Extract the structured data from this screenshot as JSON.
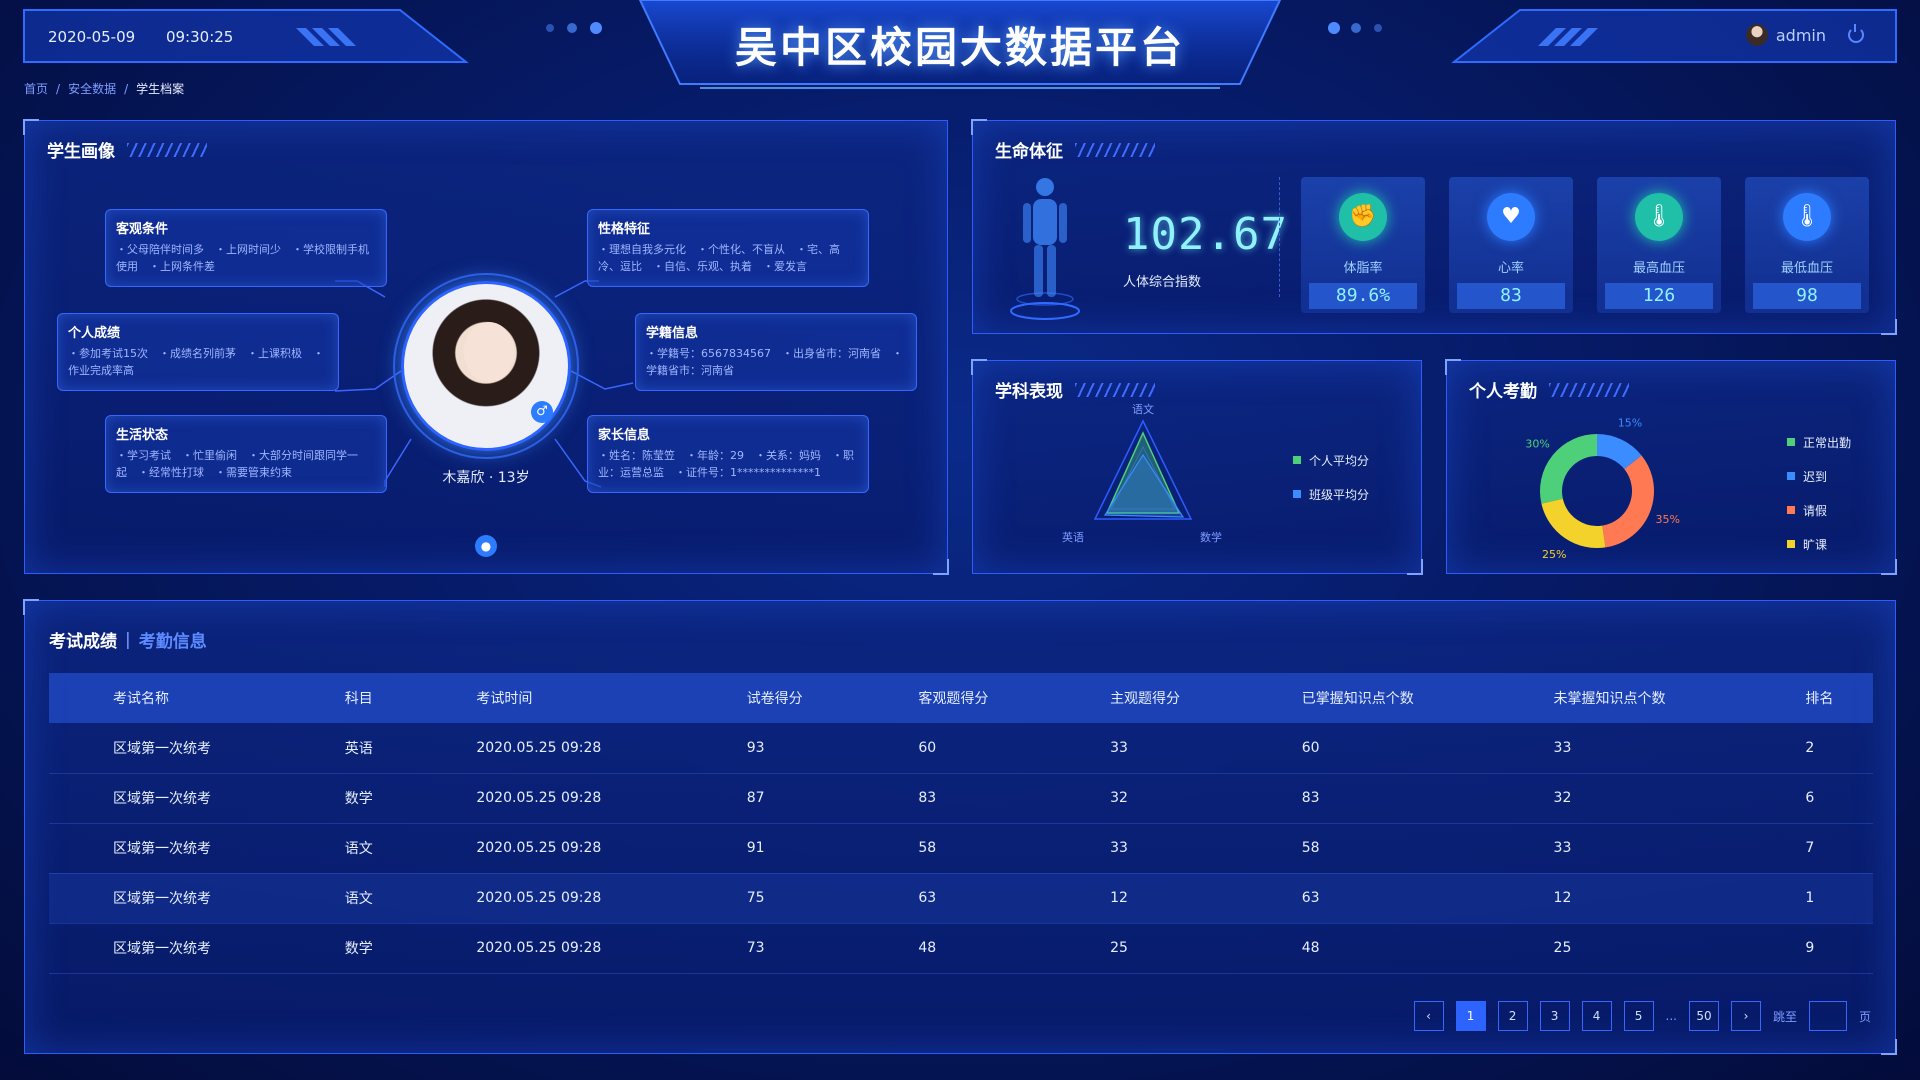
{
  "header": {
    "title": "吴中区校园大数据平台",
    "date": "2020-05-09",
    "time": "09:30:25",
    "username": "admin"
  },
  "breadcrumb": {
    "home": "首页",
    "section": "安全数据",
    "current": "学生档案"
  },
  "portrait": {
    "title": "学生画像",
    "student_name": "木嘉欣 · 13岁",
    "cards": {
      "objective": {
        "title": "客观条件",
        "text": "・父母陪伴时间多　・上网时间少　・学校限制手机使用　・上网条件差"
      },
      "achievement": {
        "title": "个人成绩",
        "text": "・参加考试15次　・成绩名列前茅　・上课积极　・作业完成率高"
      },
      "life": {
        "title": "生活状态",
        "text": "・学习考试　・忙里偷闲　・大部分时间跟同学一起　・经常性打球　・需要管束约束"
      },
      "personality": {
        "title": "性格特征",
        "text": "・理想自我多元化　・个性化、不盲从　・宅、高冷、逗比　・自信、乐观、执着　・爱发言"
      },
      "registry": {
        "title": "学籍信息",
        "text": "・学籍号：6567834567　・出身省市：河南省　・学籍省市：河南省"
      },
      "parent": {
        "title": "家长信息",
        "text": "・姓名：陈莹笠　・年龄：29　・关系：妈妈　・职业：运营总监　・证件号：1**************1"
      }
    }
  },
  "vital": {
    "title": "生命体征",
    "index_value": "102.67",
    "index_label": "人体综合指数",
    "metrics": [
      {
        "label": "体脂率",
        "value": "89.6%",
        "icon": "muscle-icon",
        "color": "#1fbfa8"
      },
      {
        "label": "心率",
        "value": "83",
        "icon": "heart-icon",
        "color": "#2d7bff"
      },
      {
        "label": "最高血压",
        "value": "126",
        "icon": "thermometer-icon",
        "color": "#1fbfa8"
      },
      {
        "label": "最低血压",
        "value": "98",
        "icon": "thermometer-icon",
        "color": "#2d7bff"
      }
    ]
  },
  "subject": {
    "title": "学科表现",
    "legend_personal": "个人平均分",
    "legend_class": "班级平均分"
  },
  "attendance": {
    "title": "个人考勤",
    "legend": [
      "正常出勤",
      "迟到",
      "请假",
      "旷课"
    ]
  },
  "chart_data": [
    {
      "type": "radar",
      "axes": [
        "语文",
        "数学",
        "英语"
      ],
      "series": [
        {
          "name": "个人平均分",
          "color": "#4ed07a"
        },
        {
          "name": "班级平均分",
          "color": "#3a8cff"
        }
      ]
    },
    {
      "type": "pie",
      "labels": [
        "正常出勤",
        "迟到",
        "请假",
        "旷课"
      ],
      "values": [
        30,
        15,
        35,
        25
      ],
      "colors": [
        "#4ed07a",
        "#3a8cff",
        "#ff7a52",
        "#f2d22b"
      ],
      "data_labels": [
        "30%",
        "15%",
        "35%",
        "25%"
      ]
    }
  ],
  "table": {
    "tab_active": "考试成绩",
    "tab_inactive": "考勤信息",
    "headers": [
      "考试名称",
      "科目",
      "考试时间",
      "试卷得分",
      "客观题得分",
      "主观题得分",
      "已掌握知识点个数",
      "未掌握知识点个数",
      "排名"
    ],
    "rows": [
      [
        "区域第一次统考",
        "英语",
        "2020.05.25  09:28",
        "93",
        "60",
        "33",
        "60",
        "33",
        "2"
      ],
      [
        "区域第一次统考",
        "数学",
        "2020.05.25  09:28",
        "87",
        "83",
        "32",
        "83",
        "32",
        "6"
      ],
      [
        "区域第一次统考",
        "语文",
        "2020.05.25  09:28",
        "91",
        "58",
        "33",
        "58",
        "33",
        "7"
      ],
      [
        "区域第一次统考",
        "语文",
        "2020.05.25  09:28",
        "75",
        "63",
        "12",
        "63",
        "12",
        "1"
      ],
      [
        "区域第一次统考",
        "数学",
        "2020.05.25  09:28",
        "73",
        "48",
        "25",
        "48",
        "25",
        "9"
      ]
    ]
  },
  "pagination": {
    "pages": [
      "1",
      "2",
      "3",
      "4",
      "5"
    ],
    "ellipsis": "...",
    "last": "50",
    "jump_label": "跳至",
    "page_suffix": "页"
  }
}
